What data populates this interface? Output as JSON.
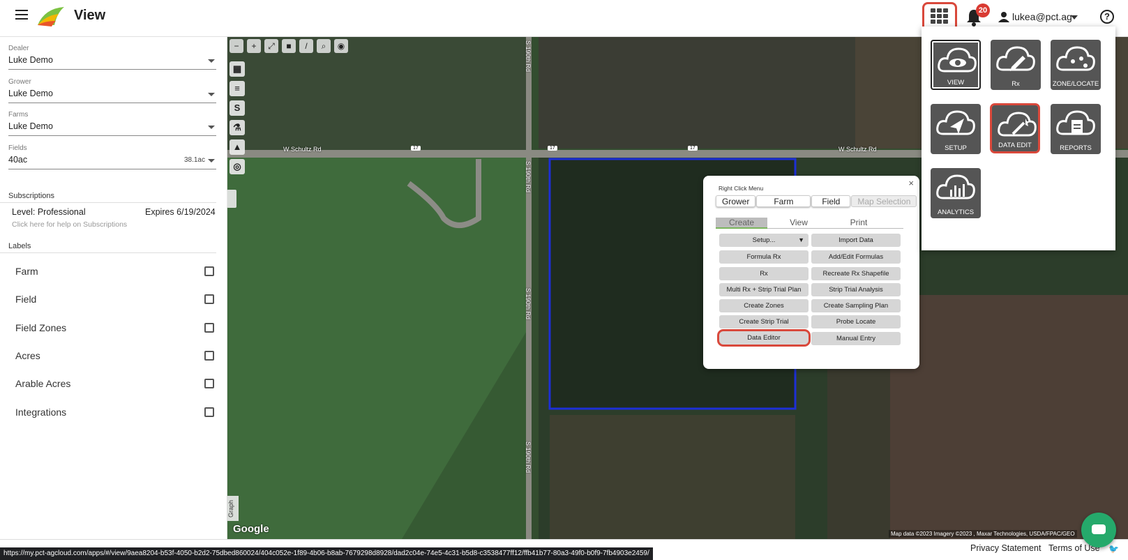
{
  "header": {
    "app_title": "View",
    "notification_count": "20",
    "user": "lukea@pct.ag",
    "help": "?"
  },
  "sidebar": {
    "dealer": {
      "label": "Dealer",
      "value": "Luke Demo"
    },
    "grower": {
      "label": "Grower",
      "value": "Luke Demo"
    },
    "farms": {
      "label": "Farms",
      "value": "Luke Demo"
    },
    "fields": {
      "label": "Fields",
      "value": "40ac",
      "acres": "38.1ac"
    },
    "subscriptions": {
      "title": "Subscriptions",
      "level": "Level: Professional",
      "expires": "Expires 6/19/2024",
      "help": "Click here for help on Subscriptions"
    },
    "labels": {
      "title": "Labels",
      "items": [
        {
          "label": "Farm",
          "checked": false
        },
        {
          "label": "Field",
          "checked": false
        },
        {
          "label": "Field Zones",
          "checked": false
        },
        {
          "label": "Acres",
          "checked": false
        },
        {
          "label": "Arable Acres",
          "checked": false
        },
        {
          "label": "Integrations",
          "checked": false
        }
      ]
    }
  },
  "map": {
    "roads": {
      "west_schultz_left": "W Schultz Rd",
      "west_schultz_right": "W Schultz Rd",
      "hwy": "17",
      "s190_top": "S 190th Rd",
      "s190_mid1": "S 190th Rd",
      "s190_mid2": "S 190th Rd",
      "s190_bottom": "S 190th Rd"
    },
    "graph_tab": "Graph",
    "google": "Google",
    "attribution": "Map data ©2023 Imagery ©2023 , Maxar Technologies, USDA/FPAC/GEO"
  },
  "right_click_menu": {
    "title": "Right Click Menu",
    "close": "×",
    "tabs": [
      "Grower",
      "Farm",
      "Field",
      "Map Selection"
    ],
    "subtabs": [
      "Create",
      "View",
      "Print"
    ],
    "buttons_left": [
      "Setup...",
      "Formula Rx",
      "Rx",
      "Multi Rx + Strip Trial Plan",
      "Create Zones",
      "Create Strip Trial",
      "Data Editor"
    ],
    "buttons_right": [
      "Import Data",
      "Add/Edit Formulas",
      "Recreate Rx Shapefile",
      "Strip Trial Analysis",
      "Create Sampling Plan",
      "Probe Locate",
      "Manual Entry"
    ]
  },
  "apps_panel": {
    "tiles": [
      {
        "name": "VIEW",
        "icon": "eye-icon"
      },
      {
        "name": "Rx",
        "icon": "pencil-icon"
      },
      {
        "name": "ZONE/LOCATE",
        "icon": "zone-icon"
      },
      {
        "name": "SETUP",
        "icon": "navigation-icon"
      },
      {
        "name": "DATA EDIT",
        "icon": "magic-wand-icon"
      },
      {
        "name": "REPORTS",
        "icon": "report-icon"
      },
      {
        "name": "ANALYTICS",
        "icon": "bar-chart-icon"
      }
    ]
  },
  "footer": {
    "status_url": "https://my.pct-agcloud.com/apps/#/view/9aea8204-b53f-4050-b2d2-75dbed860024/404c052e-1f89-4b06-b8ab-7679298d8928/dad2c04e-74e5-4c31-b5d8-c3538477ff12/ffb41b77-80a3-49f0-b0f9-7fb4903e2459/",
    "privacy": "Privacy Statement",
    "terms": "Terms of Use"
  },
  "colors": {
    "highlight": "#d9483b",
    "badge": "#d93a32",
    "chat": "#25a96b",
    "field_outline": "#1d2fd6",
    "tile": "#555555"
  }
}
